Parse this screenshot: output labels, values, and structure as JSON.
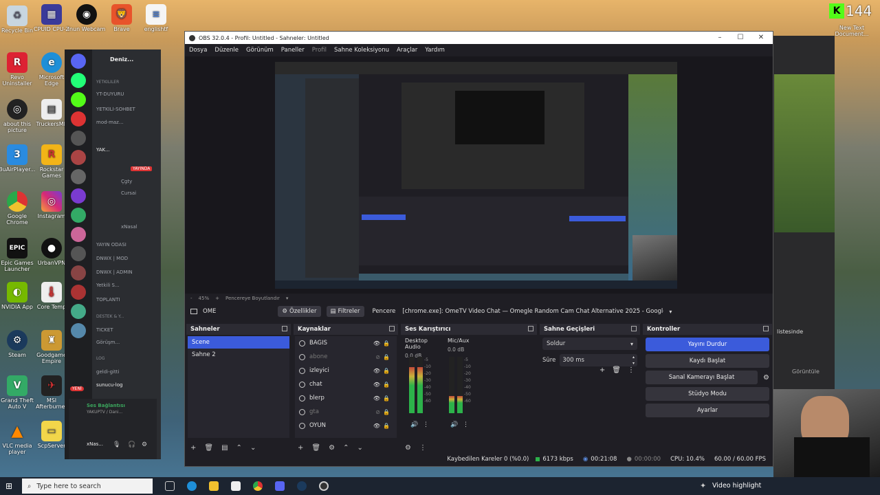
{
  "desktop": {
    "icons_left": [
      {
        "name": "recycle-bin",
        "label": "Recycle Bin"
      },
      {
        "name": "cpuid",
        "label": "CPUID CPU-Z"
      },
      {
        "name": "webcam",
        "label": "inun Webcam"
      },
      {
        "name": "brave",
        "label": "Brave"
      },
      {
        "name": "englishtf",
        "label": "englishtf"
      },
      {
        "name": "revo",
        "label": "Revo Uninstaller"
      },
      {
        "name": "edge",
        "label": "Microsoft Edge"
      },
      {
        "name": "about",
        "label": "about this picture"
      },
      {
        "name": "truckers",
        "label": "TruckersMP"
      },
      {
        "name": "3uair",
        "label": "3uAirPlayer..."
      },
      {
        "name": "rockstar",
        "label": "Rockstar Games"
      },
      {
        "name": "chrome",
        "label": "Google Chrome"
      },
      {
        "name": "instagram",
        "label": "Instagram"
      },
      {
        "name": "epic",
        "label": "Epic Games Launcher"
      },
      {
        "name": "urbanvpn",
        "label": "UrbanVPN"
      },
      {
        "name": "nvidia",
        "label": "NVIDIA App"
      },
      {
        "name": "coretemp",
        "label": "Core Temp"
      },
      {
        "name": "steam",
        "label": "Steam"
      },
      {
        "name": "goodgame",
        "label": "Goodgame Empire"
      },
      {
        "name": "gta",
        "label": "Grand Theft Auto V"
      },
      {
        "name": "msi",
        "label": "MSI Afterburner"
      },
      {
        "name": "vlc",
        "label": "VLC media player"
      },
      {
        "name": "scpserver",
        "label": "ScpServer"
      }
    ],
    "icon_right_label": "New Text Document...",
    "kick_count": "144"
  },
  "discord": {
    "user": "Deniz...",
    "channels": [
      {
        "label": "YETKİLİLER",
        "type": "cat"
      },
      {
        "label": "YT-DUYURU",
        "type": "ch"
      },
      {
        "label": "YETKİLİ-SOHBET",
        "type": "ch"
      },
      {
        "label": "mod-maz...",
        "type": "ch"
      },
      {
        "label": "YAK...",
        "type": "voice"
      },
      {
        "label": "Çgty",
        "type": "user"
      },
      {
        "label": "Cursai",
        "type": "user"
      },
      {
        "label": "xNasal",
        "type": "user"
      },
      {
        "label": "YAYIN ODASI",
        "type": "voice"
      },
      {
        "label": "DNWX | MOD",
        "type": "voice"
      },
      {
        "label": "DNWX | ADMIN",
        "type": "voice"
      },
      {
        "label": "Yetkili S...",
        "type": "voice"
      },
      {
        "label": "TOPLANTI",
        "type": "voice"
      },
      {
        "label": "DESTEK & Y...",
        "type": "cat"
      },
      {
        "label": "TICKET",
        "type": "ch"
      },
      {
        "label": "Görüşm...",
        "type": "voice"
      },
      {
        "label": "LOG",
        "type": "cat"
      },
      {
        "label": "geldi-gitti",
        "type": "ch"
      },
      {
        "label": "sunucu-log",
        "type": "ch"
      }
    ],
    "live_badge": "YAYINDA",
    "new_badge": "YENİ",
    "voice_status": "Ses Bağlantısı",
    "voice_sub": "YAKUPTV / Dani...",
    "footer_user": "xNas..."
  },
  "obs": {
    "title": "OBS 32.0.4 - Profil: Untitled - Sahneler: Untitled",
    "menu": [
      "Dosya",
      "Düzenle",
      "Görünüm",
      "Paneller",
      "Profil",
      "Sahne Koleksiyonu",
      "Araçlar",
      "Yardım"
    ],
    "zoom": {
      "minus": "-",
      "value": "45%",
      "plus": "+",
      "label": "Pencereye Boyutlandır"
    },
    "context": {
      "scene_name": "OME",
      "properties": "Özellikler",
      "filters": "Filtreler",
      "window_label": "Pencere",
      "window_value": "[chrome.exe]: OmeTV Video Chat — Omegle Random Cam Chat Alternative 2025 - Google Chro"
    },
    "scenes": {
      "title": "Sahneler",
      "items": [
        "Scene",
        "Sahne 2"
      ]
    },
    "sources": {
      "title": "Kaynaklar",
      "items": [
        {
          "label": "BAGIS",
          "visible": true
        },
        {
          "label": "abone",
          "visible": false
        },
        {
          "label": "izleyici",
          "visible": true
        },
        {
          "label": "chat",
          "visible": true
        },
        {
          "label": "blerp",
          "visible": true
        },
        {
          "label": "gta",
          "visible": false
        },
        {
          "label": "OYUN",
          "visible": true
        }
      ]
    },
    "mixer": {
      "title": "Ses Karıştırıcı",
      "channels": [
        {
          "name": "Desktop Audio",
          "db": "0.0 dB",
          "level": 0.82
        },
        {
          "name": "Mic/Aux",
          "db": "0.0 dB",
          "level": 0.3
        }
      ]
    },
    "transitions": {
      "title": "Sahne Geçişleri",
      "type": "Soldur",
      "duration_label": "Süre",
      "duration_value": "300 ms"
    },
    "controls": {
      "title": "Kontroller",
      "buttons": [
        "Yayını Durdur",
        "Kaydı Başlat",
        "Sanal Kamerayı Başlat",
        "Stüdyo Modu",
        "Ayarlar"
      ]
    },
    "status": {
      "dropped": "Kaybedilen Kareler 0 (%0.0)",
      "bitrate": "6173 kbps",
      "stream_time": "00:21:08",
      "rec_time": "00:00:00",
      "cpu": "CPU: 10.4%",
      "fps": "60.00 / 60.00 FPS"
    }
  },
  "right_window": {
    "item1": "listesinde",
    "item2": "Görüntüle"
  },
  "taskbar": {
    "search_placeholder": "Type here to search",
    "tray_label": "Video highlight"
  },
  "colors": {
    "accent": "#3b5bdb",
    "obs_bg": "#1f1e24",
    "discord_bg": "#2b2d31"
  }
}
